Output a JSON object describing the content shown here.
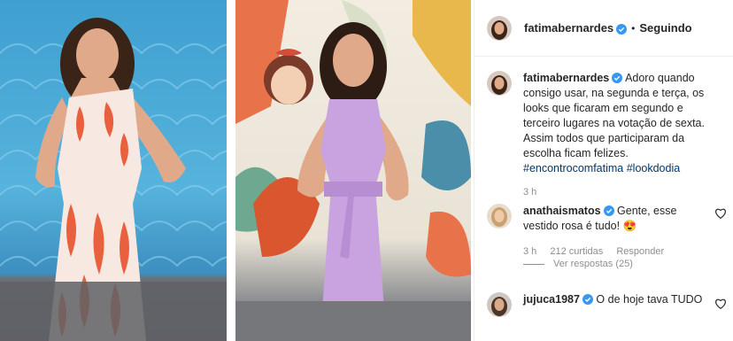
{
  "header": {
    "username": "fatimabernardes",
    "separator": "•",
    "follow_status": "Seguindo"
  },
  "caption": {
    "username": "fatimabernardes",
    "text": "Adoro quando consigo usar, na segunda e terça, os looks que ficaram em segundo e terceiro lugares na votação de sexta. Assim todos que participaram da escolha ficam felizes.",
    "hashtags": "#encontrocomfatima #lookdodia",
    "time": "3 h"
  },
  "comments": [
    {
      "username": "anathaismatos",
      "text": "Gente, esse vestido rosa é tudo!",
      "emoji": "😍",
      "time": "3 h",
      "likes": "212 curtidas",
      "reply_label": "Responder",
      "view_replies": "Ver respostas (25)"
    },
    {
      "username": "jujuca1987",
      "text": "O de hoje tava TUDO"
    }
  ],
  "colors": {
    "verified": "#3897f0",
    "hashtag": "#00376b",
    "muted": "#8e8e8e"
  },
  "icons": [
    "verified-badge-icon",
    "heart-icon"
  ]
}
